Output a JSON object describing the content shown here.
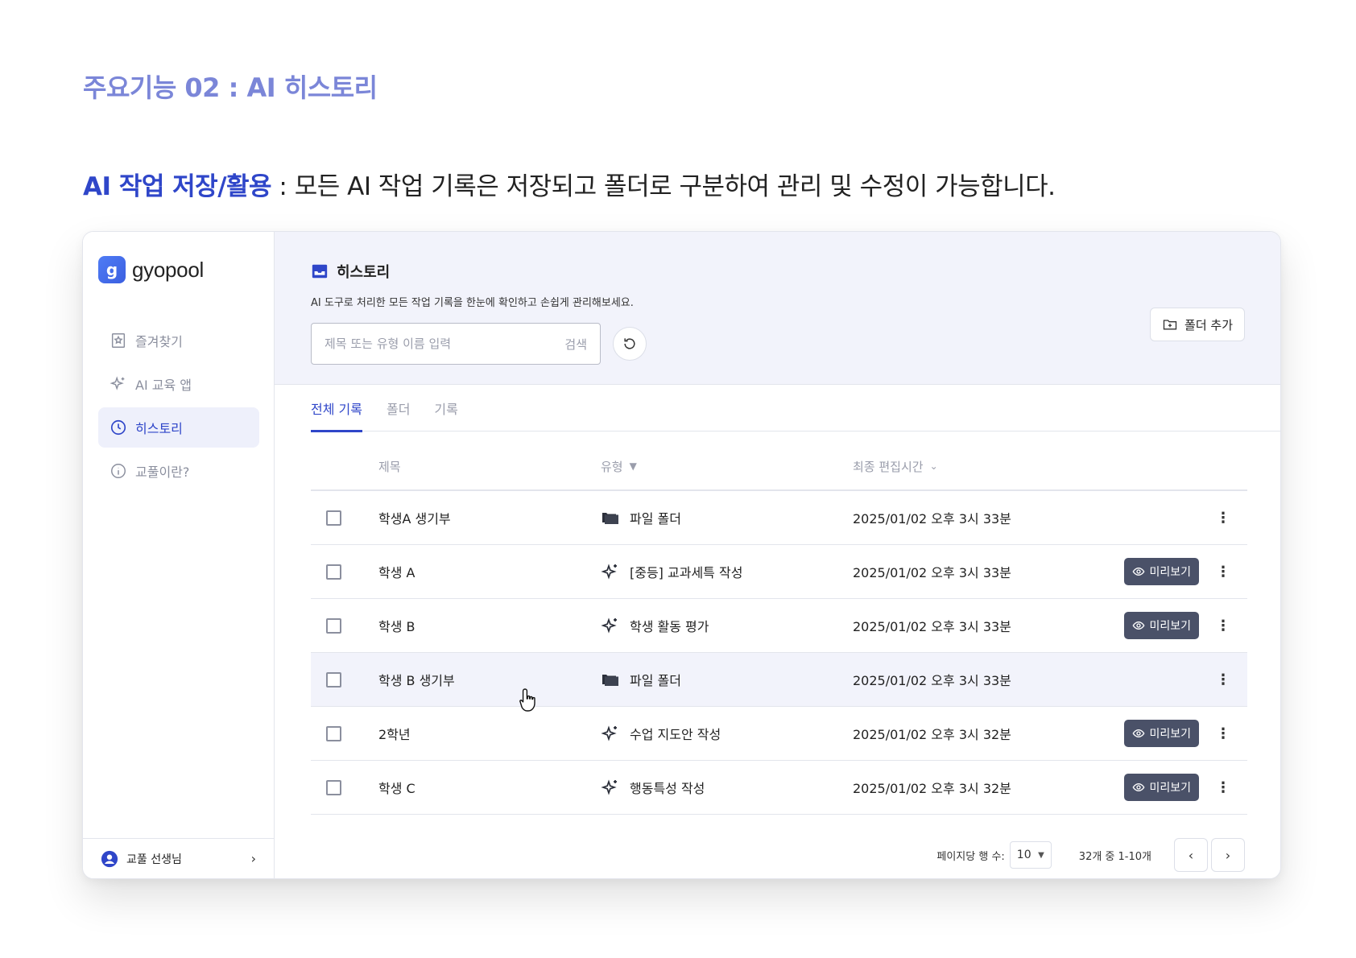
{
  "heading": {
    "feature_title": "주요기능 02 : AI 히스토리",
    "subtitle_accent": "AI 작업 저장/활용",
    "subtitle_rest": " : 모든 AI 작업 기록은 저장되고 폴더로 구분하여 관리 및 수정이 가능합니다."
  },
  "sidebar": {
    "logo_mark": "g",
    "logo_text": "gyopool",
    "items": [
      {
        "label": "즐겨찾기",
        "icon": "bookmark-icon"
      },
      {
        "label": "AI 교육 앱",
        "icon": "sparkle-icon"
      },
      {
        "label": "히스토리",
        "icon": "clock-icon",
        "active": true
      },
      {
        "label": "교풀이란?",
        "icon": "info-icon"
      }
    ],
    "user_name": "교풀 선생님"
  },
  "header": {
    "title": "히스토리",
    "description": "AI 도구로 처리한 모든 작업 기록을 한눈에 확인하고 손쉽게 관리해보세요.",
    "search_placeholder": "제목 또는 유형 이름 입력",
    "search_button": "검색",
    "add_folder_label": "폴더 추가"
  },
  "tabs": [
    {
      "label": "전체 기록",
      "active": true
    },
    {
      "label": "폴더"
    },
    {
      "label": "기록"
    }
  ],
  "table": {
    "columns": {
      "title": "제목",
      "type": "유형",
      "time": "최종 편집시간"
    },
    "preview_label": "미리보기",
    "rows": [
      {
        "title": "학생A 생기부",
        "type": "파일 폴더",
        "kind": "folder",
        "time": "2025/01/02 오후 3시 33분",
        "preview": false
      },
      {
        "title": "학생 A",
        "type": "[중등] 교과세특 작성",
        "kind": "ai",
        "time": "2025/01/02 오후 3시 33분",
        "preview": true
      },
      {
        "title": "학생 B",
        "type": "학생 활동 평가",
        "kind": "ai",
        "time": "2025/01/02 오후 3시 33분",
        "preview": true
      },
      {
        "title": "학생 B 생기부",
        "type": "파일 폴더",
        "kind": "folder",
        "time": "2025/01/02 오후 3시 33분",
        "preview": false,
        "hover": true
      },
      {
        "title": "2학년",
        "type": "수업 지도안 작성",
        "kind": "ai",
        "time": "2025/01/02 오후 3시 32분",
        "preview": true
      },
      {
        "title": "학생 C",
        "type": "행동특성 작성",
        "kind": "ai",
        "time": "2025/01/02 오후 3시 32분",
        "preview": true
      }
    ]
  },
  "pagination": {
    "rows_per_page_label": "페이지당 행 수:",
    "rows_per_page": "10",
    "range": "32개 중 1-10개"
  },
  "colors": {
    "accent": "#2f46c9",
    "feature_title": "#7b86d8",
    "header_bg": "#f2f3fb",
    "preview_button": "#4a5168"
  }
}
